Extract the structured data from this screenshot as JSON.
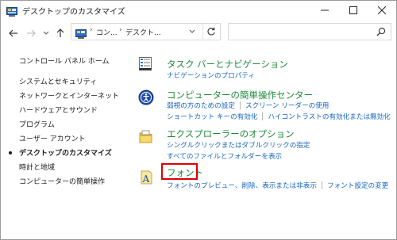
{
  "window": {
    "title": "デスクトップのカスタマイズ"
  },
  "address": {
    "crumbs": [
      "コン...",
      "デスクト..."
    ],
    "search_placeholder": ""
  },
  "sidebar": {
    "items": [
      {
        "label": "コントロール パネル ホーム",
        "current": false
      },
      {
        "label": "システムとセキュリティ",
        "current": false
      },
      {
        "label": "ネットワークとインターネット",
        "current": false
      },
      {
        "label": "ハードウェアとサウンド",
        "current": false
      },
      {
        "label": "プログラム",
        "current": false
      },
      {
        "label": "ユーザー アカウント",
        "current": false
      },
      {
        "label": "デスクトップのカスタマイズ",
        "current": true
      },
      {
        "label": "時計と地域",
        "current": false
      },
      {
        "label": "コンピューターの簡単操作",
        "current": false
      }
    ]
  },
  "groups": [
    {
      "icon": "taskbar-navigation-icon",
      "title": "タスク バーとナビゲーション",
      "rows": [
        [
          "ナビゲーションのプロパティ"
        ]
      ]
    },
    {
      "icon": "ease-of-access-icon",
      "title": "コンピューターの簡単操作センター",
      "rows": [
        [
          "弱視の方のための設定",
          "スクリーン リーダーの使用"
        ],
        [
          "ショートカット キーの有効化",
          "ハイコントラストの有効化または無効化"
        ]
      ]
    },
    {
      "icon": "file-explorer-options-icon",
      "title": "エクスプローラーのオプション",
      "rows": [
        [
          "シングルクリックまたはダブルクリックの指定"
        ],
        [
          "すべてのファイルとフォルダーを表示"
        ]
      ]
    },
    {
      "icon": "fonts-icon",
      "title": "フォント",
      "rows": [
        [
          "フォントのプレビュー、削除、表示または非表示",
          "フォント設定の変更"
        ]
      ]
    }
  ],
  "colors": {
    "group_title": "#1e8a3b",
    "link": "#1565c0",
    "highlight": "#e00000"
  }
}
